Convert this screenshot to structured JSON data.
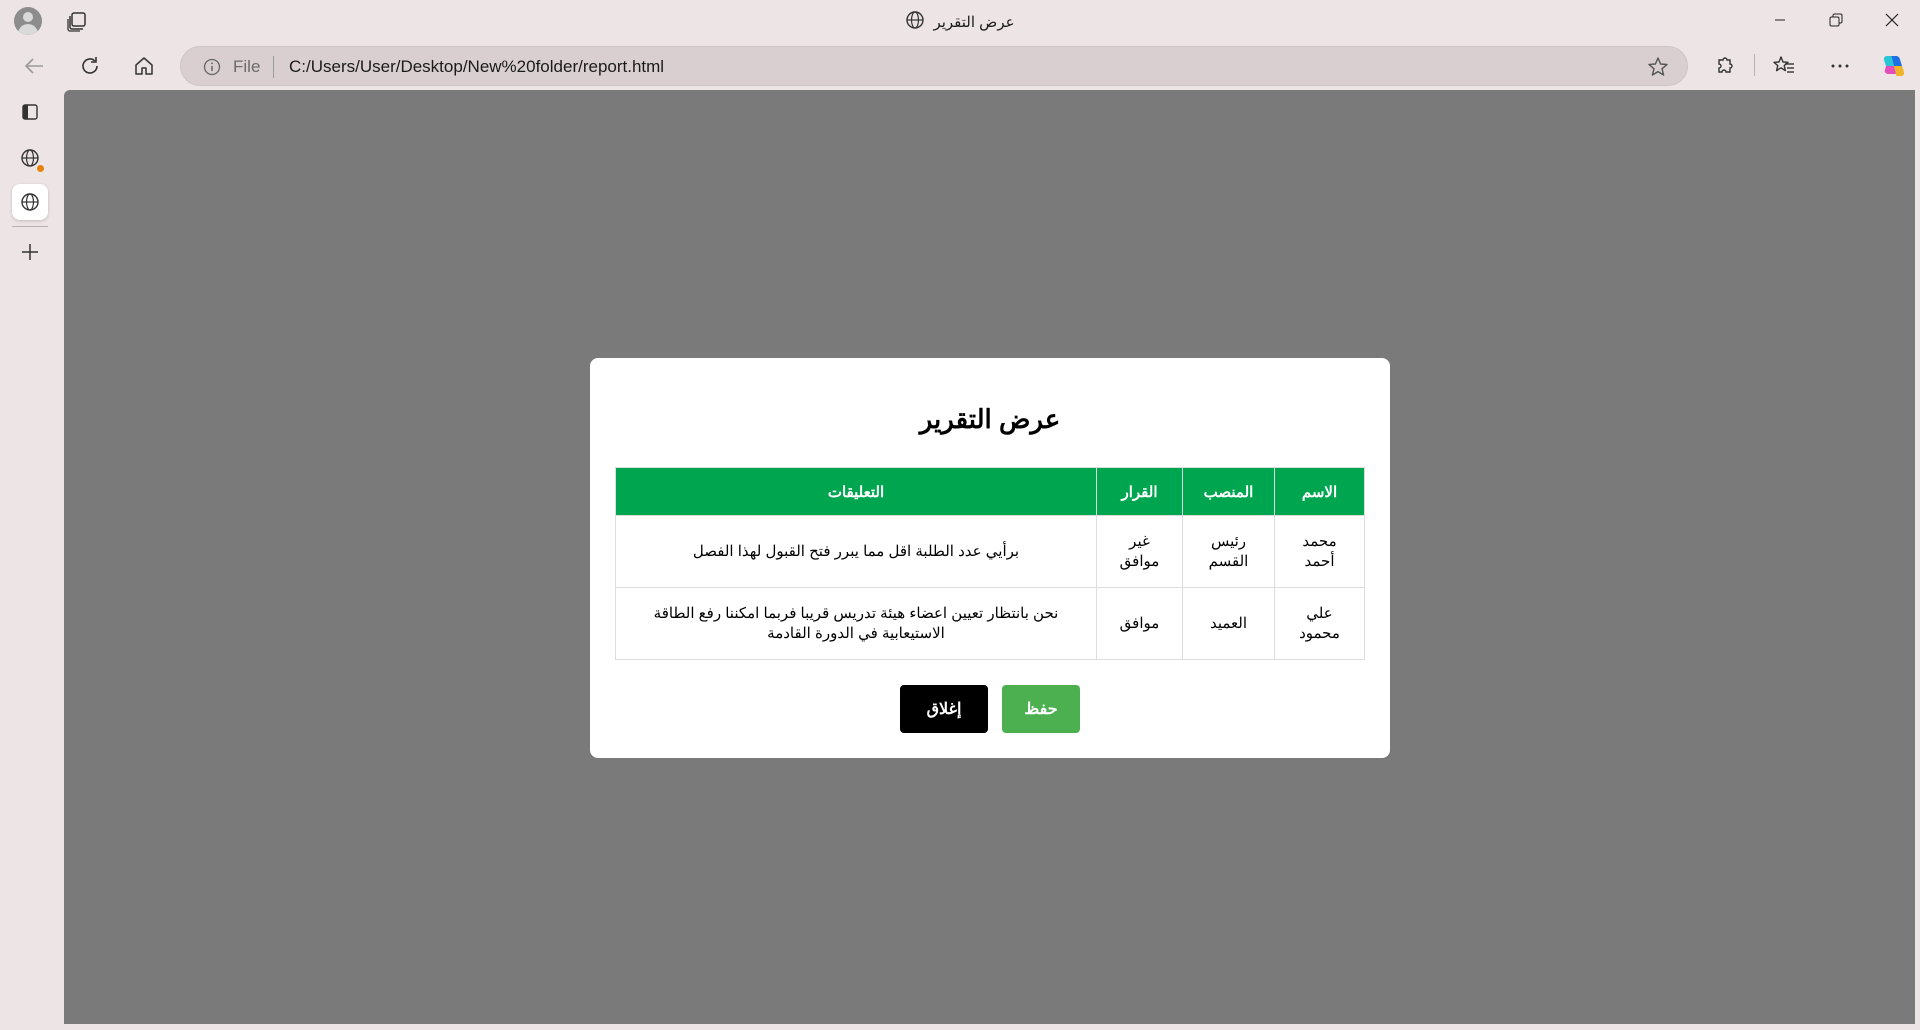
{
  "window": {
    "title": "عرض التقرير"
  },
  "address_bar": {
    "scheme_label": "File",
    "url": "C:/Users/User/Desktop/New%20folder/report.html"
  },
  "modal": {
    "title": "عرض التقرير",
    "headers": {
      "name": "الاسم",
      "position": "المنصب",
      "decision": "القرار",
      "comments": "التعليقات"
    },
    "rows": [
      {
        "name": "محمد أحمد",
        "position": "رئيس القسم",
        "decision": "غير موافق",
        "comments": "برأيي عدد الطلبة اقل مما يبرر فتح القبول لهذا الفصل"
      },
      {
        "name": "علي محمود",
        "position": "العميد",
        "decision": "موافق",
        "comments": "نحن بانتظار تعيين اعضاء هيئة تدريس قريبا فربما امكننا رفع الطاقة الاستيعابية في الدورة القادمة"
      }
    ],
    "buttons": {
      "save": "حفظ",
      "close": "إغلاق"
    }
  },
  "colors": {
    "header_green": "#00a64f",
    "save_green": "#4caf50",
    "overlay_gray": "#7a7a7a"
  }
}
